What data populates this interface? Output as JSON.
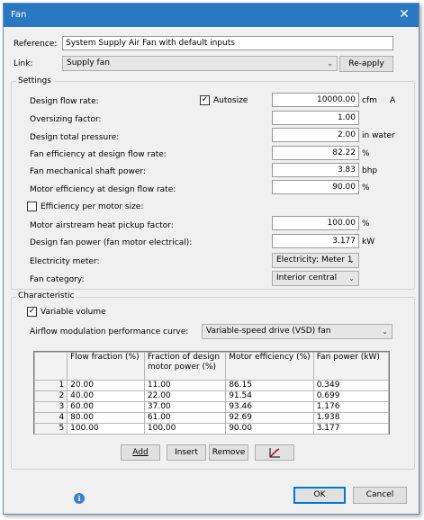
{
  "window": {
    "title": "Fan"
  },
  "reference": {
    "label": "Reference:",
    "value": "System Supply Air Fan with default inputs"
  },
  "link": {
    "label": "Link:",
    "value": "Supply fan",
    "reapply": "Re-apply"
  },
  "settings": {
    "group_label": "Settings",
    "design_flow_rate": {
      "label": "Design flow rate:",
      "autosize": "Autosize",
      "autosize_checked": true,
      "value": "10000.00",
      "unit": "cfm",
      "flag": "A"
    },
    "oversizing": {
      "label": "Oversizing factor:",
      "value": "1.00"
    },
    "design_pressure": {
      "label": "Design total pressure:",
      "value": "2.00",
      "unit": "in water"
    },
    "fan_efficiency": {
      "label": "Fan efficiency at design flow rate:",
      "value": "82.22",
      "unit": "%"
    },
    "shaft_power": {
      "label": "Fan mechanical shaft power:",
      "value": "3.83",
      "unit": "bhp"
    },
    "motor_efficiency": {
      "label": "Motor efficiency at design flow rate:",
      "value": "90.00",
      "unit": "%"
    },
    "efficiency_per_motor": {
      "label": "Efficiency per motor size:",
      "checked": false
    },
    "heat_pickup": {
      "label": "Motor airstream heat pickup factor:",
      "value": "100.00",
      "unit": "%"
    },
    "design_fan_power": {
      "label": "Design fan power (fan motor electrical):",
      "value": "3.177",
      "unit": "kW"
    },
    "electricity_meter": {
      "label": "Electricity meter:",
      "value": "Electricity: Meter 1"
    },
    "fan_category": {
      "label": "Fan category:",
      "value": "Interior central"
    }
  },
  "characteristic": {
    "group_label": "Characteristic",
    "variable_volume": {
      "label": "Variable volume",
      "checked": true
    },
    "curve": {
      "label": "Airflow modulation performance curve:",
      "value": "Variable-speed drive (VSD) fan"
    },
    "columns": [
      "Flow fraction (%)",
      "Fraction of design motor power (%)",
      "Motor efficiency (%)",
      "Fan power (kW)"
    ],
    "rows": [
      {
        "n": "1",
        "flow": "20.00",
        "frac": "11.00",
        "eff": "86.15",
        "power": "0.349"
      },
      {
        "n": "2",
        "flow": "40.00",
        "frac": "22.00",
        "eff": "91.54",
        "power": "0.699"
      },
      {
        "n": "3",
        "flow": "60.00",
        "frac": "37.00",
        "eff": "93.46",
        "power": "1.176"
      },
      {
        "n": "4",
        "flow": "80.00",
        "frac": "61.00",
        "eff": "92.69",
        "power": "1.938"
      },
      {
        "n": "5",
        "flow": "100.00",
        "frac": "100.00",
        "eff": "90.00",
        "power": "3.177"
      }
    ],
    "buttons": {
      "add": "Add",
      "insert": "Insert",
      "remove": "Remove"
    }
  },
  "footer": {
    "ok": "OK",
    "cancel": "Cancel"
  },
  "icons": {
    "info": "info-icon",
    "close": "close-icon",
    "chart": "chart-icon",
    "chevron": "chevron-down-icon"
  },
  "colors": {
    "titlebar": "#2b78c2",
    "accent": "#0078d7"
  }
}
